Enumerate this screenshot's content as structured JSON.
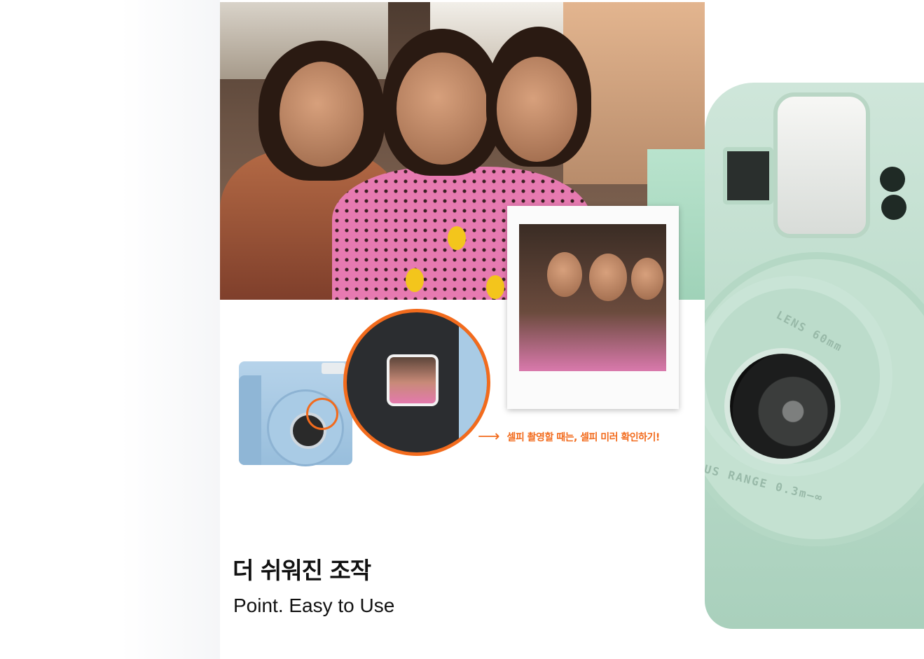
{
  "section": {
    "title": "더 쉬워진 조작",
    "subtitle": "Point. Easy to Use"
  },
  "callout": {
    "caption": "셀피 촬영할 때는, 셀피 미러 확인하기!",
    "arrow_icon": "arrow-right-icon"
  },
  "camera_labels": {
    "lens": "LENS 60mm",
    "focus": "US RANGE 0.3m–∞"
  },
  "colors": {
    "accent": "#f26b1d",
    "mint": "#bcdccb",
    "sky_blue": "#a9cbe5",
    "shirt_pink": "#e77ab1"
  }
}
